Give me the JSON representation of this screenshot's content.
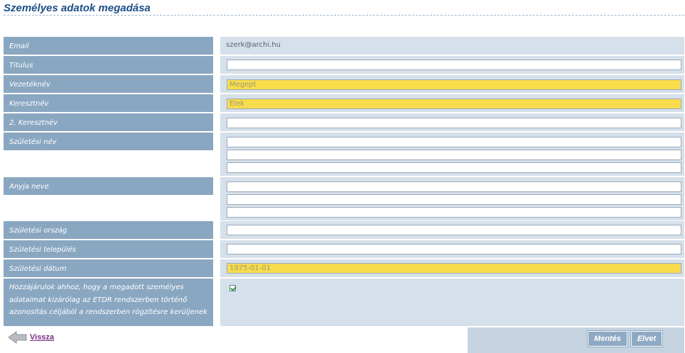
{
  "page": {
    "title": "Személyes adatok megadása"
  },
  "form": {
    "email": {
      "label": "Email",
      "value": "szerk@archi.hu"
    },
    "titulus": {
      "label": "Titulus",
      "value": ""
    },
    "vezeteknev": {
      "label": "Vezetéknév",
      "value": "Megept"
    },
    "keresztnev": {
      "label": "Keresztnév",
      "value": "Elek"
    },
    "keresztnev2": {
      "label": "2. Keresztnév",
      "value": ""
    },
    "szuletesi_nev": {
      "label": "Születési név",
      "values": [
        "",
        "",
        ""
      ]
    },
    "anyja_neve": {
      "label": "Anyja neve",
      "values": [
        "",
        "",
        ""
      ]
    },
    "szuletesi_orszag": {
      "label": "Születési ország",
      "value": ""
    },
    "szuletesi_telepules": {
      "label": "Születési település",
      "value": ""
    },
    "szuletesi_datum": {
      "label": "Születési dátum",
      "value": "1975-01-01"
    },
    "consent": {
      "lines": [
        "Hozzájárulok ahhoz, hogy a megadott személyes",
        "adataimat kizárólag az ETDR rendszerben történő",
        "azonosítás céljából a rendszerben rögzítésre kerüljenek"
      ],
      "checked": true
    }
  },
  "nav": {
    "back_label": "Vissza"
  },
  "actions": {
    "save_label": "Mentés",
    "submit_label": "Elvet"
  },
  "colors": {
    "label_bg": "#8aa7c2",
    "value_bg": "#d6e0ea",
    "required_bg": "#f8dc4b",
    "title": "#1c4f86"
  }
}
